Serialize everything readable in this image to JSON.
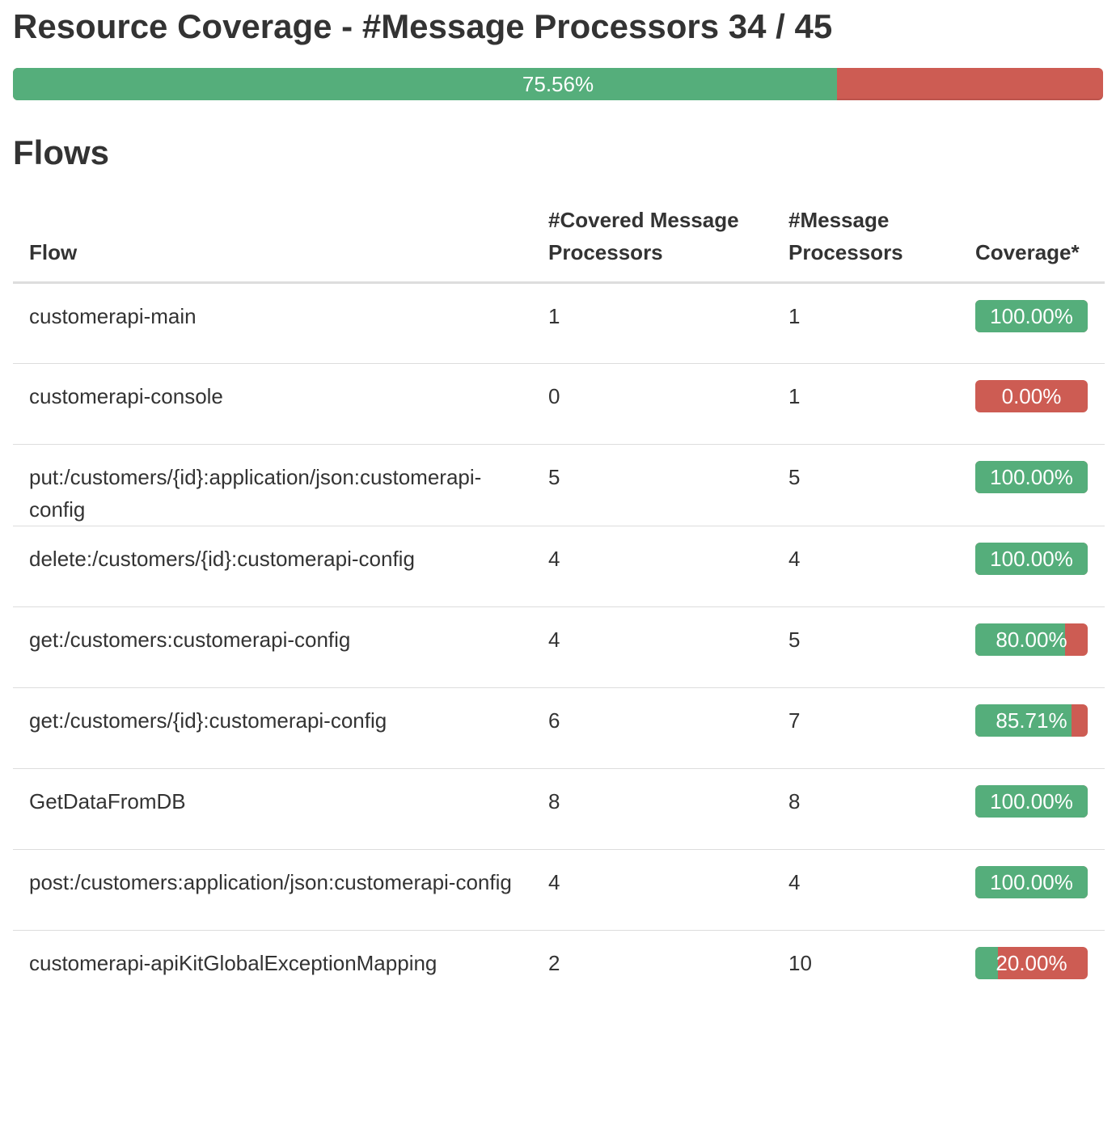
{
  "page": {
    "title": "Resource Coverage - #Message Processors 34 / 45"
  },
  "summary": {
    "percent": 75.56,
    "label": "75.56%"
  },
  "flows": {
    "title": "Flows",
    "headers": {
      "flow": "Flow",
      "covered": "#Covered Message Processors",
      "total": "#Message Processors",
      "coverage": "Coverage*"
    },
    "rows": [
      {
        "flow": "customerapi-main",
        "covered": "1",
        "total": "1",
        "coverage": 100.0,
        "coverage_label": "100.00%"
      },
      {
        "flow": "customerapi-console",
        "covered": "0",
        "total": "1",
        "coverage": 0.0,
        "coverage_label": "0.00%"
      },
      {
        "flow": "put:/customers/{id}:application/json:customerapi-config",
        "covered": "5",
        "total": "5",
        "coverage": 100.0,
        "coverage_label": "100.00%"
      },
      {
        "flow": "delete:/customers/{id}:customerapi-config",
        "covered": "4",
        "total": "4",
        "coverage": 100.0,
        "coverage_label": "100.00%"
      },
      {
        "flow": "get:/customers:customerapi-config",
        "covered": "4",
        "total": "5",
        "coverage": 80.0,
        "coverage_label": "80.00%"
      },
      {
        "flow": "get:/customers/{id}:customerapi-config",
        "covered": "6",
        "total": "7",
        "coverage": 85.71,
        "coverage_label": "85.71%"
      },
      {
        "flow": "GetDataFromDB",
        "covered": "8",
        "total": "8",
        "coverage": 100.0,
        "coverage_label": "100.00%"
      },
      {
        "flow": "post:/customers:application/json:customerapi-config",
        "covered": "4",
        "total": "4",
        "coverage": 100.0,
        "coverage_label": "100.00%"
      },
      {
        "flow": "customerapi-apiKitGlobalExceptionMapping",
        "covered": "2",
        "total": "10",
        "coverage": 20.0,
        "coverage_label": "20.00%"
      }
    ]
  },
  "colors": {
    "covered": "#55ae7b",
    "uncovered": "#cd5c53"
  }
}
